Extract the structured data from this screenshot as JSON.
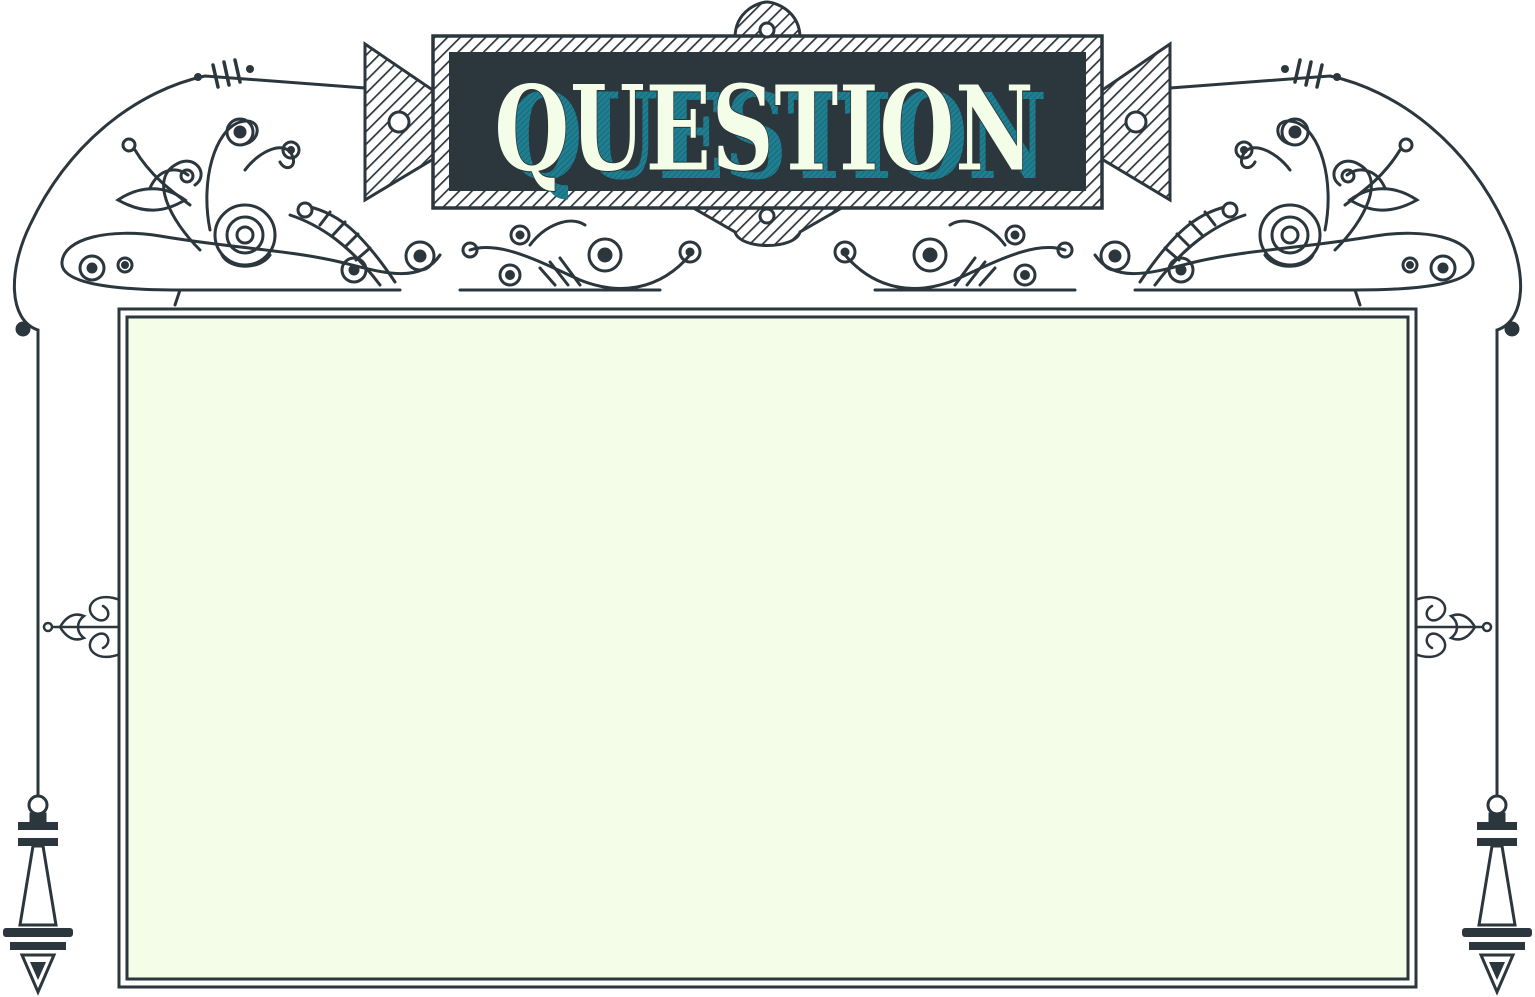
{
  "sign": {
    "title": "QUESTION"
  },
  "panel": {
    "content": ""
  },
  "colors": {
    "ink": "#2b363d",
    "teal": "#1f7f91",
    "cream": "#f3fde7",
    "background": "#ffffff"
  },
  "icons": {
    "header_sign": "banner-sign-icon",
    "left_flourish": "scroll-flourish-icon",
    "right_flourish": "scroll-flourish-icon",
    "left_pendant": "pendant-finial-icon",
    "right_pendant": "pendant-finial-icon",
    "side_bracket": "fleur-bracket-icon"
  }
}
